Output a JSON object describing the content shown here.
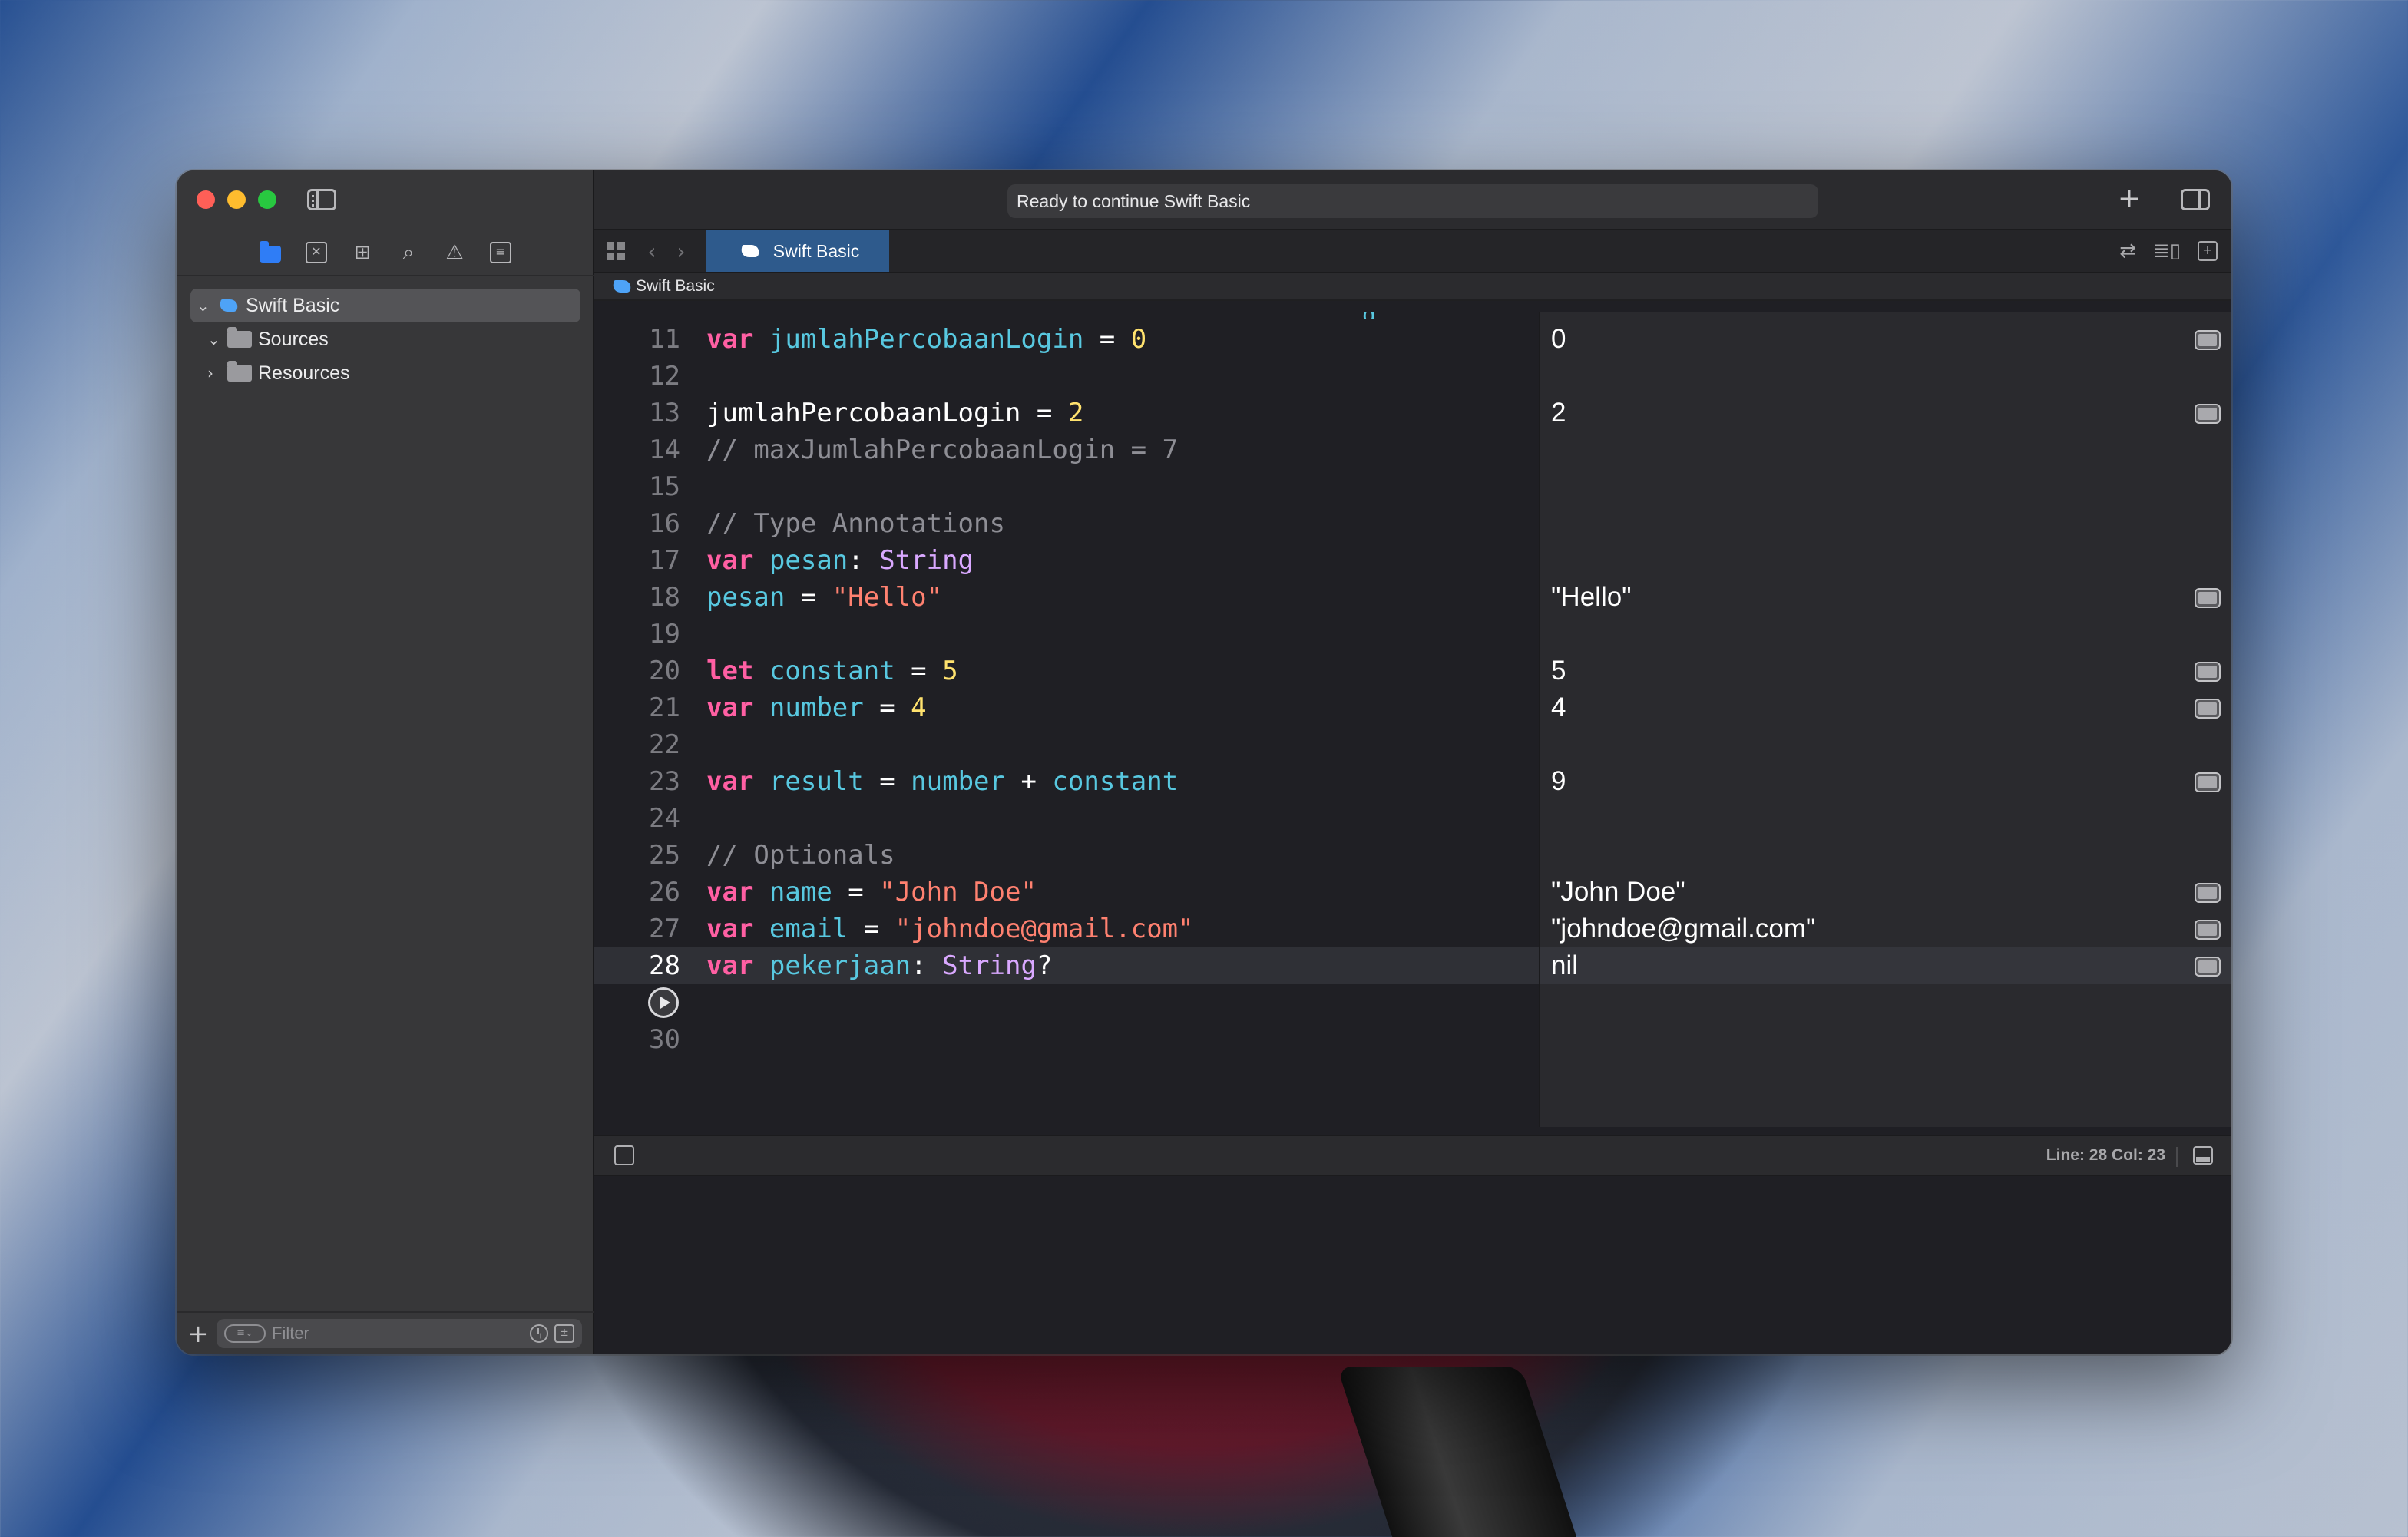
{
  "window": {
    "activity_status": "Ready to continue Swift Basic",
    "add_symbol": "+"
  },
  "sidebar": {
    "tree": [
      {
        "label": "Swift Basic",
        "expanded": true,
        "icon": "swift-icon",
        "selected": true
      },
      {
        "label": "Sources",
        "expanded": true,
        "icon": "folder-icon"
      },
      {
        "label": "Resources",
        "expanded": false,
        "icon": "folder-icon"
      }
    ],
    "filter_placeholder": "Filter",
    "add_symbol": "+"
  },
  "navigator_icons": [
    "project-navigator-icon",
    "source-control-icon",
    "symbol-navigator-icon",
    "find-icon",
    "issue-icon",
    "report-icon"
  ],
  "editor": {
    "tab_label": "Swift Basic",
    "breadcrumb": "Swift Basic",
    "current_line": 28,
    "lines": [
      {
        "n": "11",
        "tokens": [
          [
            "kw",
            "var"
          ],
          [
            "pl",
            " "
          ],
          [
            "vn",
            "jumlahPercobaanLogin"
          ],
          [
            "pl",
            " = "
          ],
          [
            "num",
            "0"
          ]
        ]
      },
      {
        "n": "12",
        "tokens": []
      },
      {
        "n": "13",
        "tokens": [
          [
            "pl",
            "jumlahPercobaanLogin = "
          ],
          [
            "num",
            "2"
          ]
        ]
      },
      {
        "n": "14",
        "tokens": [
          [
            "cm",
            "// maxJumlahPercobaanLogin = 7"
          ]
        ]
      },
      {
        "n": "15",
        "tokens": []
      },
      {
        "n": "16",
        "tokens": [
          [
            "cm",
            "// Type Annotations"
          ]
        ]
      },
      {
        "n": "17",
        "tokens": [
          [
            "kw",
            "var"
          ],
          [
            "pl",
            " "
          ],
          [
            "vn",
            "pesan"
          ],
          [
            "pl",
            ": "
          ],
          [
            "ty",
            "String"
          ]
        ]
      },
      {
        "n": "18",
        "tokens": [
          [
            "vn",
            "pesan"
          ],
          [
            "pl",
            " = "
          ],
          [
            "str",
            "\"Hello\""
          ]
        ]
      },
      {
        "n": "19",
        "tokens": []
      },
      {
        "n": "20",
        "tokens": [
          [
            "kw",
            "let"
          ],
          [
            "pl",
            " "
          ],
          [
            "vn",
            "constant"
          ],
          [
            "pl",
            " = "
          ],
          [
            "num",
            "5"
          ]
        ]
      },
      {
        "n": "21",
        "tokens": [
          [
            "kw",
            "var"
          ],
          [
            "pl",
            " "
          ],
          [
            "vn",
            "number"
          ],
          [
            "pl",
            " = "
          ],
          [
            "num",
            "4"
          ]
        ]
      },
      {
        "n": "22",
        "tokens": []
      },
      {
        "n": "23",
        "tokens": [
          [
            "kw",
            "var"
          ],
          [
            "pl",
            " "
          ],
          [
            "vn",
            "result"
          ],
          [
            "pl",
            " = "
          ],
          [
            "vn",
            "number"
          ],
          [
            "pl",
            " + "
          ],
          [
            "vn",
            "constant"
          ]
        ]
      },
      {
        "n": "24",
        "tokens": []
      },
      {
        "n": "25",
        "tokens": [
          [
            "cm",
            "// Optionals"
          ]
        ]
      },
      {
        "n": "26",
        "tokens": [
          [
            "kw",
            "var"
          ],
          [
            "pl",
            " "
          ],
          [
            "vn",
            "name"
          ],
          [
            "pl",
            " = "
          ],
          [
            "str",
            "\"John Doe\""
          ]
        ]
      },
      {
        "n": "27",
        "tokens": [
          [
            "kw",
            "var"
          ],
          [
            "pl",
            " "
          ],
          [
            "vn",
            "email"
          ],
          [
            "pl",
            " = "
          ],
          [
            "str",
            "\"johndoe@gmail.com\""
          ]
        ]
      },
      {
        "n": "28",
        "tokens": [
          [
            "kw",
            "var"
          ],
          [
            "pl",
            " "
          ],
          [
            "vn",
            "pekerjaan"
          ],
          [
            "pl",
            ": "
          ],
          [
            "ty",
            "String"
          ],
          [
            "pl",
            "?"
          ]
        ]
      },
      {
        "n": "",
        "tokens": [],
        "run_button": true
      },
      {
        "n": "30",
        "tokens": []
      }
    ]
  },
  "results": [
    {
      "line": "11",
      "value": "0"
    },
    {
      "line": "13",
      "value": "2"
    },
    {
      "line": "18",
      "value": "\"Hello\""
    },
    {
      "line": "20",
      "value": "5"
    },
    {
      "line": "21",
      "value": "4"
    },
    {
      "line": "23",
      "value": "9"
    },
    {
      "line": "26",
      "value": "\"John Doe\""
    },
    {
      "line": "27",
      "value": "\"johndoe@gmail.com\""
    },
    {
      "line": "28",
      "value": "nil"
    }
  ],
  "statusbar": {
    "position": "Line: 28  Col: 23"
  },
  "colors": {
    "keyword": "#ff5fa3",
    "variable": "#58c8e0",
    "type": "#d9a8ff",
    "number": "#ffe26e",
    "string": "#ff8170",
    "comment": "#8e8e95",
    "tab_active": "#2e5a8c"
  }
}
